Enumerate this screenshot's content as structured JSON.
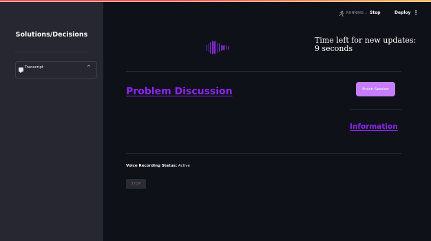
{
  "sidebar": {
    "title": "Solutions/Decisions",
    "expander": {
      "label": "Transcript",
      "chevron": "^",
      "icon": "chat-bubble-icon"
    }
  },
  "header": {
    "status": "RUNNING...",
    "stop_label": "Stop",
    "deploy_label": "Deploy",
    "menu_glyph": "⋮",
    "running_icon": "running-person-icon"
  },
  "main": {
    "time_left_label": "Time left for new updates:",
    "time_left_value": "9 seconds",
    "problem_heading": "Problem Discussion",
    "finish_label": "Finish Session",
    "info_heading": "Information",
    "status_label": "Voice Recording Status:",
    "status_value": "Active",
    "stop_recording_label": "STOP"
  },
  "colors": {
    "background": "#0e1117",
    "sidebar": "#262730",
    "accent": "#8e24f6",
    "button": "#c77dff"
  }
}
